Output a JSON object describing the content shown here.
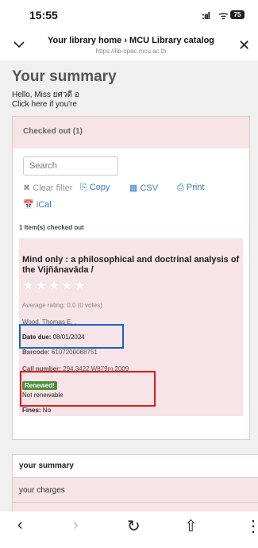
{
  "status": {
    "time": "15:55",
    "signal": ":ııl",
    "wifi": "ᯤ",
    "battery": "75"
  },
  "url_bar": {
    "title": "Your library home › MCU Library catalog",
    "url": "https://lib-opac.mcu.ac.th"
  },
  "page": {
    "heading": "Your summary",
    "hello": "Hello, Miss ยศวดี อ",
    "click_here": "Click here if you're"
  },
  "checked_out": {
    "title": "Checked out (1)",
    "search_placeholder": "Search",
    "toolbar": {
      "clear": "✖ Clear filter",
      "copy": "⎘ Copy",
      "csv": "▦ CSV",
      "print": "⎙ Print",
      "ical": "📅 iCal"
    },
    "count_text": "1 Item(s) checked out",
    "item": {
      "title": "Mind only : a philosophical and doctrinal analysis of the Vijñānavāda /",
      "stars": "★★★★★",
      "rating": "Average rating: 0.0 (0 votes)",
      "author": "Wood, Thomas E. ,",
      "date_due_label": "Date due:",
      "date_due": "08/01/2024",
      "barcode_label": "Barcode:",
      "barcode": "6107200068751",
      "call_label": "Call number:",
      "call_number": "294.3422 W879m 2009",
      "renewed": "Renewed!",
      "not_renewable": "Not renewable",
      "fines_label": "Fines:",
      "fines": "No"
    }
  },
  "menu": {
    "summary": "your summary",
    "charges": "your charges"
  },
  "bottom_nav": {
    "back": "‹",
    "forward": "›",
    "reload": "↻",
    "share": "⇧",
    "more": "⋮"
  }
}
